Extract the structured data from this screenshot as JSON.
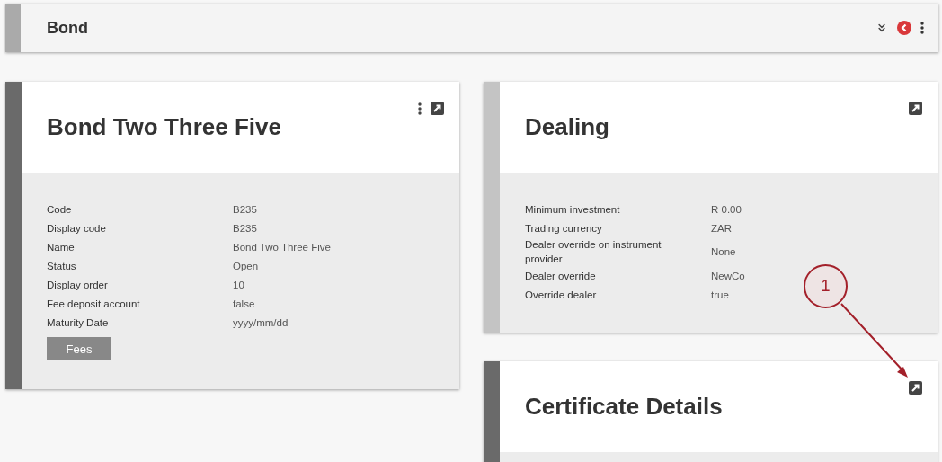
{
  "header": {
    "title": "Bond"
  },
  "columns": [
    {
      "cards": [
        {
          "title": "Bond Two Three Five",
          "color": "#6a6a6a",
          "menu": true,
          "fields": [
            {
              "label": "Code",
              "value": "B235"
            },
            {
              "label": "Display code",
              "value": "B235"
            },
            {
              "label": "Name",
              "value": "Bond Two Three Five"
            },
            {
              "label": "Status",
              "value": "Open"
            },
            {
              "label": "Display order",
              "value": "10"
            },
            {
              "label": "Fee deposit account",
              "value": "false"
            },
            {
              "label": "Maturity Date",
              "value": "yyyy/mm/dd"
            }
          ],
          "button": "Fees"
        }
      ]
    },
    {
      "cards": [
        {
          "title": "Dealing",
          "color": "#c4c4c4",
          "menu": false,
          "fields": [
            {
              "label": "Minimum investment",
              "value": "R 0.00"
            },
            {
              "label": "Trading currency",
              "value": "ZAR"
            },
            {
              "label": "Dealer override on instrument provider",
              "value": "None"
            },
            {
              "label": "Dealer override",
              "value": "NewCo"
            },
            {
              "label": "Override dealer",
              "value": "true"
            }
          ]
        },
        {
          "title": "Certificate Details",
          "color": "#6a6a6a",
          "menu": false
        }
      ]
    }
  ],
  "annotation": {
    "label": "1"
  }
}
